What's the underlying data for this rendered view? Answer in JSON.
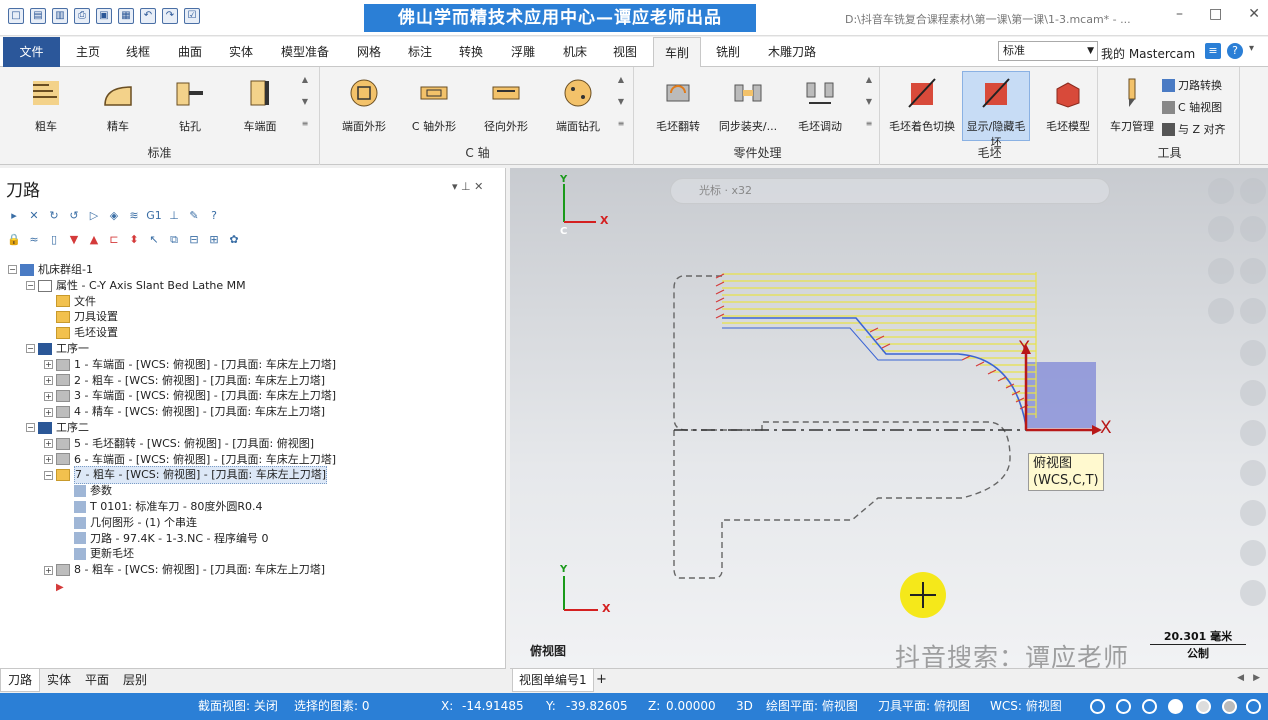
{
  "title_bar": {
    "banner": "佛山学而精技术应用中心—谭应老师出品",
    "file_path": "D:\\抖音车铣复合课程素材\\第一课\\第一课\\1-3.mcam* - ...",
    "min": "–",
    "max": "□",
    "close": "✕"
  },
  "ribbon_tabs": [
    "文件",
    "主页",
    "线框",
    "曲面",
    "实体",
    "模型准备",
    "网格",
    "标注",
    "转换",
    "浮雕",
    "机床",
    "视图",
    "车削",
    "铣削",
    "木雕刀路"
  ],
  "style_select": "标准",
  "my_mastercam": "我的 Mastercam",
  "ribbon_groups": [
    {
      "label": "标准",
      "buttons": [
        "粗车",
        "精车",
        "钻孔",
        "车端面"
      ]
    },
    {
      "label": "C 轴",
      "buttons": [
        "端面外形",
        "C 轴外形",
        "径向外形",
        "端面钻孔"
      ]
    },
    {
      "label": "零件处理",
      "buttons": [
        "毛坯翻转",
        "同步装夹/...",
        "毛坯调动"
      ]
    },
    {
      "label": "毛坯",
      "buttons": [
        "毛坯着色切换",
        "显示/隐藏毛坯",
        "毛坯模型"
      ]
    },
    {
      "label": "工具",
      "buttons": [
        "车刀管理"
      ],
      "side_items": [
        "刀路转换",
        "C 轴视图",
        "与 Z 对齐"
      ]
    }
  ],
  "panel": {
    "title": "刀路",
    "pin": "▾ ⊥ ✕"
  },
  "tree": [
    {
      "level": 0,
      "text": "机床群组-1",
      "icon": "machine",
      "exp": "−"
    },
    {
      "level": 1,
      "text": "属性 - C-Y Axis Slant Bed Lathe MM",
      "icon": "prop",
      "exp": "−"
    },
    {
      "level": 2,
      "text": "文件",
      "icon": "folder"
    },
    {
      "level": 2,
      "text": "刀具设置",
      "icon": "folder"
    },
    {
      "level": 2,
      "text": "毛坯设置",
      "icon": "folder"
    },
    {
      "level": 1,
      "text": "工序一",
      "icon": "ops",
      "exp": "−"
    },
    {
      "level": 2,
      "text": "1 - 车端面 - [WCS: 俯视图] - [刀具面: 车床左上刀塔]",
      "icon": "grayfolder",
      "exp": "+"
    },
    {
      "level": 2,
      "text": "2 - 粗车 - [WCS: 俯视图] - [刀具面: 车床左上刀塔]",
      "icon": "grayfolder",
      "exp": "+"
    },
    {
      "level": 2,
      "text": "3 - 车端面 - [WCS: 俯视图] - [刀具面: 车床左上刀塔]",
      "icon": "grayfolder",
      "exp": "+"
    },
    {
      "level": 2,
      "text": "4 - 精车 - [WCS: 俯视图] - [刀具面: 车床左上刀塔]",
      "icon": "grayfolder",
      "exp": "+"
    },
    {
      "level": 1,
      "text": "工序二",
      "icon": "ops",
      "exp": "−"
    },
    {
      "level": 2,
      "text": "5 - 毛坯翻转 - [WCS: 俯视图] - [刀具面: 俯视图]",
      "icon": "grayfolder",
      "exp": "+"
    },
    {
      "level": 2,
      "text": "6 - 车端面 - [WCS: 俯视图] - [刀具面: 车床左上刀塔]",
      "icon": "grayfolder",
      "exp": "+"
    },
    {
      "level": 2,
      "text": "7 - 粗车 - [WCS: 俯视图] - [刀具面: 车床左上刀塔]",
      "icon": "folder",
      "exp": "−",
      "selected": true
    },
    {
      "level": 3,
      "text": "参数",
      "icon": "small"
    },
    {
      "level": 3,
      "text": "T 0101: 标准车刀 - 80度外圆R0.4",
      "icon": "small"
    },
    {
      "level": 3,
      "text": "几何图形 - (1) 个串连",
      "icon": "small"
    },
    {
      "level": 3,
      "text": "刀路 - 97.4K - 1-3.NC - 程序编号 0",
      "icon": "small"
    },
    {
      "level": 3,
      "text": "更新毛坯",
      "icon": "small"
    },
    {
      "level": 2,
      "text": "8 - 粗车 - [WCS: 俯视图] - [刀具面: 车床左上刀塔]",
      "icon": "grayfolder",
      "exp": "+"
    },
    {
      "level": 2,
      "text": "",
      "icon": "arrow"
    }
  ],
  "bottom_tabs": [
    "刀路",
    "实体",
    "平面",
    "层别"
  ],
  "viewport": {
    "toolbar_label": "光标",
    "toolbar_zoom": "x32",
    "axis_y": "Y",
    "axis_x": "X",
    "axis_c": "C",
    "tooltip_line1": "俯视图",
    "tooltip_line2": "(WCS,C,T)",
    "view_name": "俯视图",
    "scale_value": "20.301 毫米",
    "scale_unit": "公制",
    "watermark": "抖音搜索：谭应老师"
  },
  "vp_tabs": {
    "tab": "视图单编号1",
    "add": "+"
  },
  "status": {
    "section_view": "截面视图: 关闭",
    "selected": "选择的图素: 0",
    "x_label": "X:",
    "x_val": "-14.91485",
    "y_label": "Y:",
    "y_val": "-39.82605",
    "z_label": "Z:",
    "z_val": "0.00000",
    "mode": "3D",
    "draw_plane": "绘图平面: 俯视图",
    "tool_plane": "刀具平面: 俯视图",
    "wcs": "WCS: 俯视图"
  },
  "colors": {
    "accent": "#2b7fd6",
    "file_tab": "#2b579a",
    "toolpath_yellow": "#e8e24a",
    "toolpath_red": "#d43a3a",
    "toolpath_blue": "#3a64d4"
  }
}
